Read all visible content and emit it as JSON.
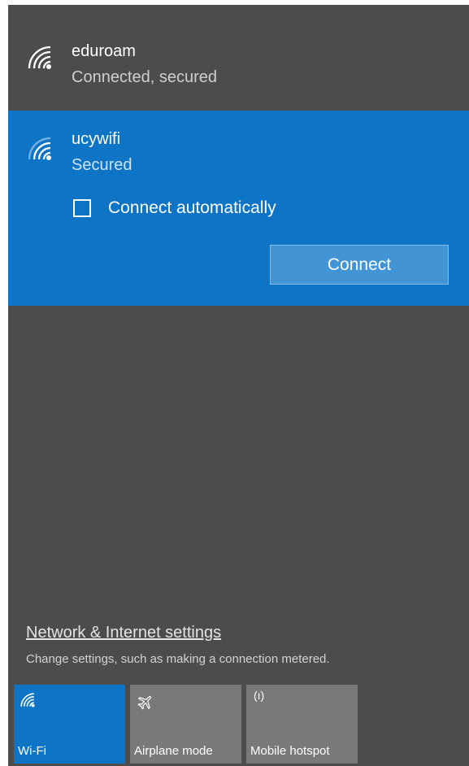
{
  "networks": [
    {
      "name": "eduroam",
      "status": "Connected, secured",
      "icon": "wifi-icon"
    },
    {
      "name": "ucywifi",
      "status": "Secured",
      "icon": "wifi-icon"
    }
  ],
  "selected_network": {
    "auto_connect_label": "Connect automatically",
    "auto_connect_checked": false,
    "connect_button_label": "Connect"
  },
  "settings": {
    "link_label": "Network & Internet settings",
    "description": "Change settings, such as making a connection metered."
  },
  "quick_actions": [
    {
      "label": "Wi-Fi",
      "icon": "wifi-icon",
      "active": true
    },
    {
      "label": "Airplane mode",
      "icon": "airplane-icon",
      "active": false
    },
    {
      "label": "Mobile hotspot",
      "icon": "hotspot-icon",
      "glyph": "(ı)",
      "active": false
    }
  ],
  "colors": {
    "panel_background": "#4c4c4c",
    "accent": "#0e74c6",
    "connect_button": "#4294d4",
    "inactive_tile": "#797979",
    "text": "#ffffff"
  }
}
